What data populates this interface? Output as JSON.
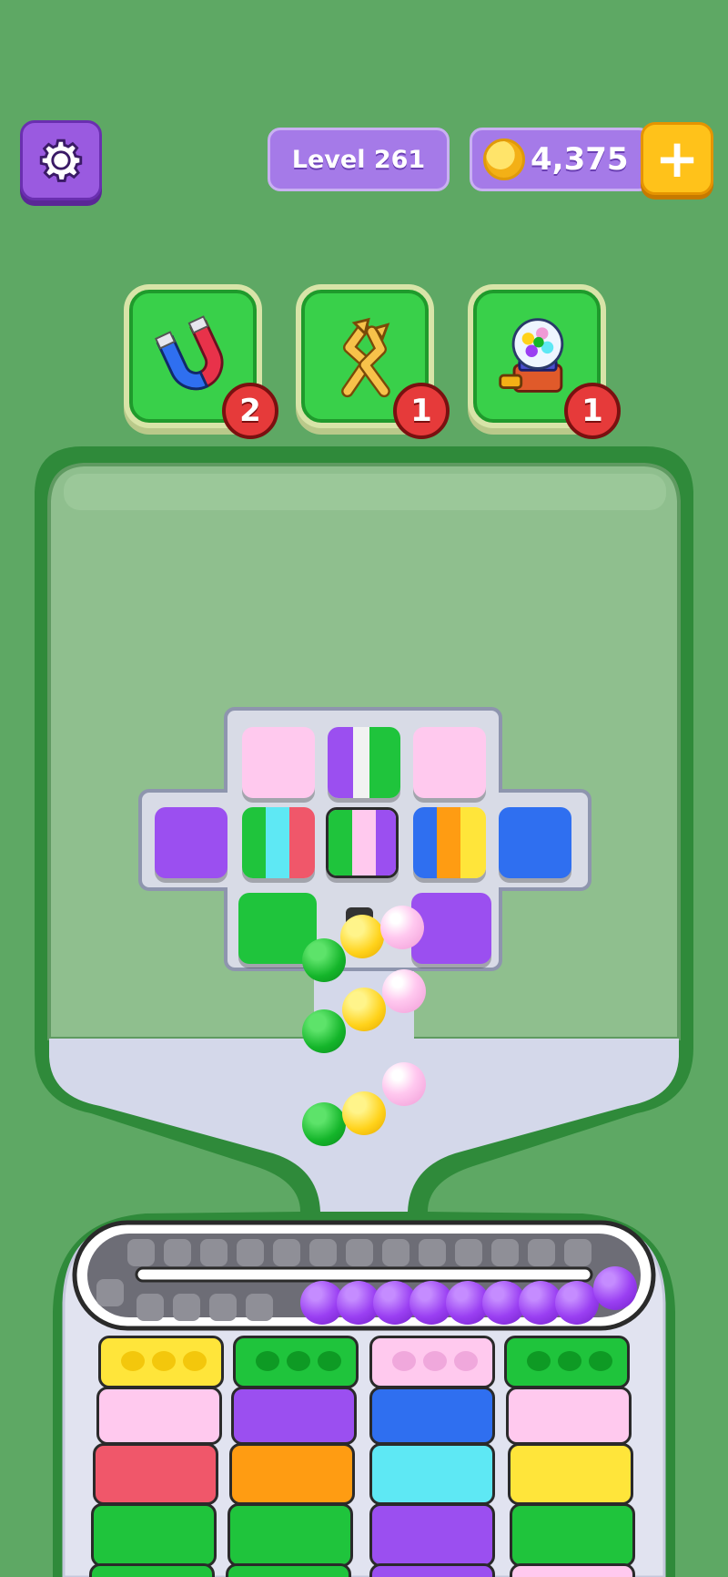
{
  "header": {
    "level_label": "Level 261",
    "coins": "4,375",
    "plus_label": "+"
  },
  "boosters": [
    {
      "icon": "magnet-icon",
      "count": "2"
    },
    {
      "icon": "shuffle-arrows-icon",
      "count": "1"
    },
    {
      "icon": "gumball-machine-icon",
      "count": "1"
    }
  ],
  "colors": {
    "purple": "#9b4ff0",
    "pink": "#ffc9ee",
    "green": "#1fc43c",
    "blue": "#2f6ff0",
    "yellow": "#ffe53a",
    "orange": "#ff9c12",
    "cyan": "#5ee8f4",
    "red": "#f0576a"
  }
}
